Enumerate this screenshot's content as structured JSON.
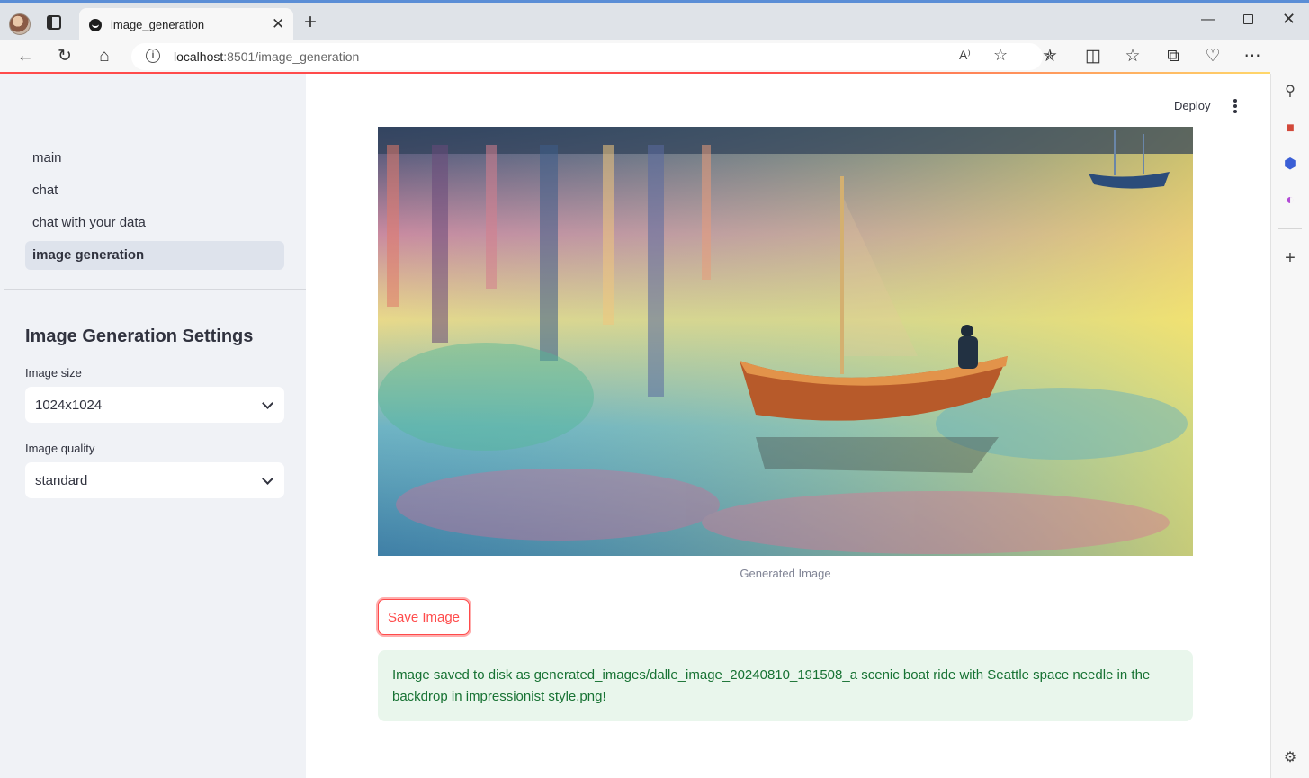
{
  "browser": {
    "tab_title": "image_generation",
    "tab_close": "✕",
    "new_tab": "+",
    "url_host": "localhost",
    "url_path": ":8501/image_generation",
    "read_aloud": "A⁾",
    "controls": {
      "minimize": "—",
      "close": "✕"
    }
  },
  "sidebar": {
    "nav_items": [
      "main",
      "chat",
      "chat with your data",
      "image generation"
    ],
    "active_index": 3,
    "settings_title": "Image Generation Settings",
    "image_size": {
      "label": "Image size",
      "value": "1024x1024"
    },
    "image_quality": {
      "label": "Image quality",
      "value": "standard"
    }
  },
  "header": {
    "deploy_label": "Deploy"
  },
  "main": {
    "image_caption": "Generated Image",
    "save_button_label": "Save Image",
    "success_message": "Image saved to disk as generated_images/dalle_image_20240810_191508_a scenic boat ride with Seattle space needle in the backdrop in impressionist style.png!"
  },
  "colors": {
    "accent": "#ff4b4b",
    "success_bg": "#e9f6ec",
    "success_text": "#177233",
    "sidebar_bg": "#f0f2f6"
  },
  "icons": [
    "back-icon",
    "refresh-icon",
    "home-icon",
    "info-icon",
    "favorite-icon",
    "extensions-icon",
    "split-screen-icon",
    "favorites-icon",
    "collections-icon",
    "browser-essentials-icon",
    "more-icon",
    "copilot-icon",
    "search-icon",
    "tools-icon",
    "office-icon",
    "designer-icon",
    "add-icon",
    "settings-icon"
  ]
}
